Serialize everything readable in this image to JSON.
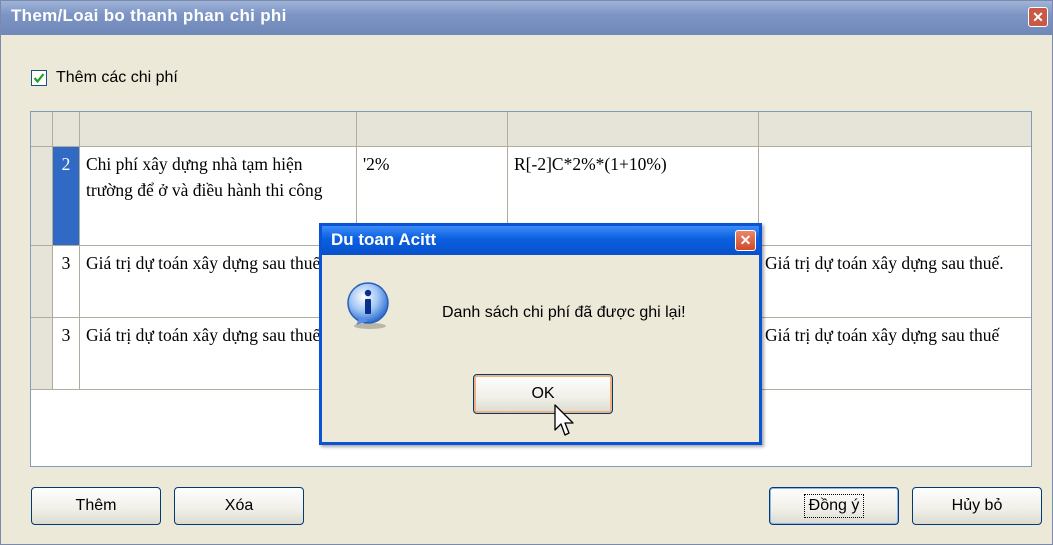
{
  "window": {
    "title": "Them/Loai bo thanh phan chi phi",
    "close_glyph": "✕"
  },
  "checkbox": {
    "label": "Thêm các chi phí",
    "checked": true
  },
  "grid": {
    "rows": [
      {
        "num": "2",
        "name": "Chi phí xây dựng nhà tạm hiện trường để ở và điều hành thi công",
        "col2": "'2%",
        "col3": "R[-2]C*2%*(1+10%)",
        "col4": ""
      },
      {
        "num": "3",
        "name": "Giá trị dự toán xây dựng sau thuế",
        "col2": "",
        "col3": "",
        "col4": "Giá trị dự toán xây dựng sau thuế."
      },
      {
        "num": "3",
        "name": "Giá trị dự toán xây dựng sau thuế.",
        "col2": "",
        "col3": "",
        "col4": "Giá trị dự toán xây dựng sau thuế"
      }
    ]
  },
  "buttons": {
    "add": "Thêm",
    "delete": "Xóa",
    "agree": "Đồng ý",
    "cancel": "Hủy bỏ"
  },
  "dialog": {
    "title": "Du toan Acitt",
    "message": "Danh sách chi phí đã được ghi lại!",
    "ok": "OK",
    "icon": "info-icon",
    "close_glyph": "✕"
  },
  "colors": {
    "dialog_border": "#0854d4",
    "selection": "#316ac5",
    "title_inactive": "#7d95c4"
  }
}
